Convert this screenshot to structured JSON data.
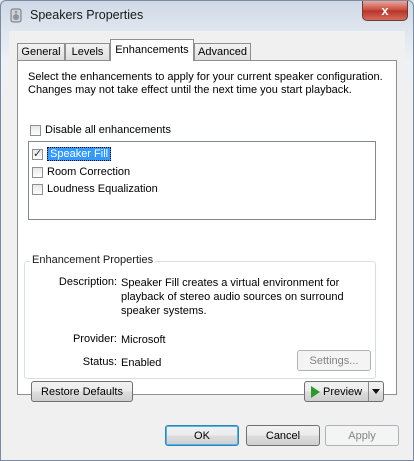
{
  "window": {
    "title": "Speakers Properties",
    "close_label": "x"
  },
  "tabs": [
    {
      "label": "General",
      "active": false
    },
    {
      "label": "Levels",
      "active": false
    },
    {
      "label": "Enhancements",
      "active": true
    },
    {
      "label": "Advanced",
      "active": false
    }
  ],
  "enhancements": {
    "instructions": "Select the enhancements to apply for your current speaker configuration. Changes may not take effect until the next time you start playback.",
    "disable_all_label": "Disable all enhancements",
    "disable_all_checked": false,
    "items": [
      {
        "label": "Speaker Fill",
        "checked": true,
        "selected": true
      },
      {
        "label": "Room Correction",
        "checked": false,
        "selected": false
      },
      {
        "label": "Loudness Equalization",
        "checked": false,
        "selected": false
      }
    ]
  },
  "properties": {
    "group_title": "Enhancement Properties",
    "description_label": "Description:",
    "description_value": "Speaker Fill creates a virtual environment for playback of stereo audio sources on surround speaker systems.",
    "provider_label": "Provider:",
    "provider_value": "Microsoft",
    "status_label": "Status:",
    "status_value": "Enabled",
    "settings_button": "Settings..."
  },
  "buttons": {
    "restore_defaults": "Restore Defaults",
    "preview": "Preview",
    "ok": "OK",
    "cancel": "Cancel",
    "apply": "Apply"
  },
  "colors": {
    "selection": "#3399ff",
    "close_button": "#c8463a",
    "preview_arrow": "#2a9a2a"
  }
}
